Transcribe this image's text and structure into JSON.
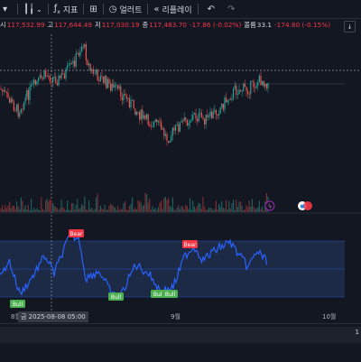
{
  "toolbar": {
    "interval_icon": "interval-icon",
    "candles_icon": "candles-icon",
    "indicators_label": "지표",
    "layouts_icon": "layout-grid-icon",
    "alert_label": "얼러트",
    "replay_label": "리플레이",
    "undo_icon": "undo-icon",
    "redo_icon": "redo-icon"
  },
  "ohlc": {
    "open_label": "시",
    "open_value": "117,532.99",
    "high_label": "고",
    "high_value": "117,644.49",
    "low_label": "저",
    "low_value": "117,030.19",
    "close_label": "종",
    "close_value": "117,483.70",
    "change_value": "-17.86 (-0.02%)",
    "volume_label": "볼륨",
    "volume_value": "33.1",
    "extra_change": "-174.80 (-0.15%)"
  },
  "colors": {
    "background": "#131722",
    "up": "#26a69a",
    "down": "#ef5350",
    "indicator_line": "#2962ff",
    "bear_label": "#f23645",
    "bull_label": "#4caf50"
  },
  "oscillator": {
    "signals": [
      {
        "type": "bear",
        "text": "Bear"
      },
      {
        "type": "bear",
        "text": "Bear"
      },
      {
        "type": "bull",
        "text": "Bull"
      },
      {
        "type": "bull",
        "text": "Bull"
      },
      {
        "type": "bull",
        "text": "Bull"
      },
      {
        "type": "bull",
        "text": "Bull"
      }
    ]
  },
  "timeline": {
    "labels": [
      "8월",
      "9월",
      "10월"
    ],
    "crosshair": "금 2025-08-08  05:00",
    "corner": "1"
  },
  "markers": {
    "event_icon": "lightning-icon",
    "flag_icon": "us-flag-icon"
  }
}
